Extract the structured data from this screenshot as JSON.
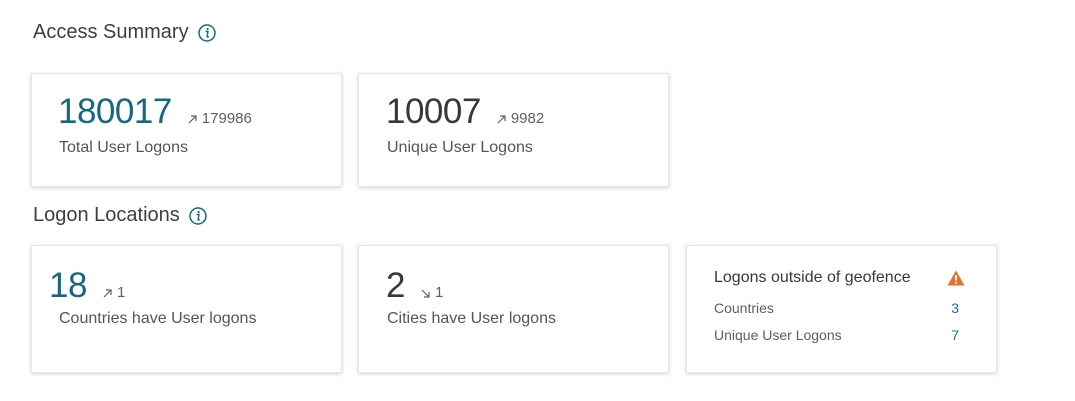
{
  "access_summary": {
    "title": "Access Summary",
    "cards": [
      {
        "value": "180017",
        "trend_value": "179986",
        "trend_direction": "up",
        "label": "Total User Logons"
      },
      {
        "value": "10007",
        "trend_value": "9982",
        "trend_direction": "up",
        "label": "Unique User Logons"
      }
    ]
  },
  "logon_locations": {
    "title": "Logon Locations",
    "cards": [
      {
        "value": "18",
        "trend_value": "1",
        "trend_direction": "up",
        "label": "Countries have User logons"
      },
      {
        "value": "2",
        "trend_value": "1",
        "trend_direction": "down",
        "label": "Cities have User logons"
      }
    ],
    "geofence": {
      "title": "Logons outside of geofence",
      "warning_icon": "warning-triangle-icon",
      "rows": [
        {
          "label": "Countries",
          "value": "3"
        },
        {
          "label": "Unique User Logons",
          "value": "7"
        }
      ]
    }
  },
  "colors": {
    "accent_teal": "#15697f",
    "link_blue": "#1b6fa6",
    "warning_orange": "#e0702a"
  }
}
